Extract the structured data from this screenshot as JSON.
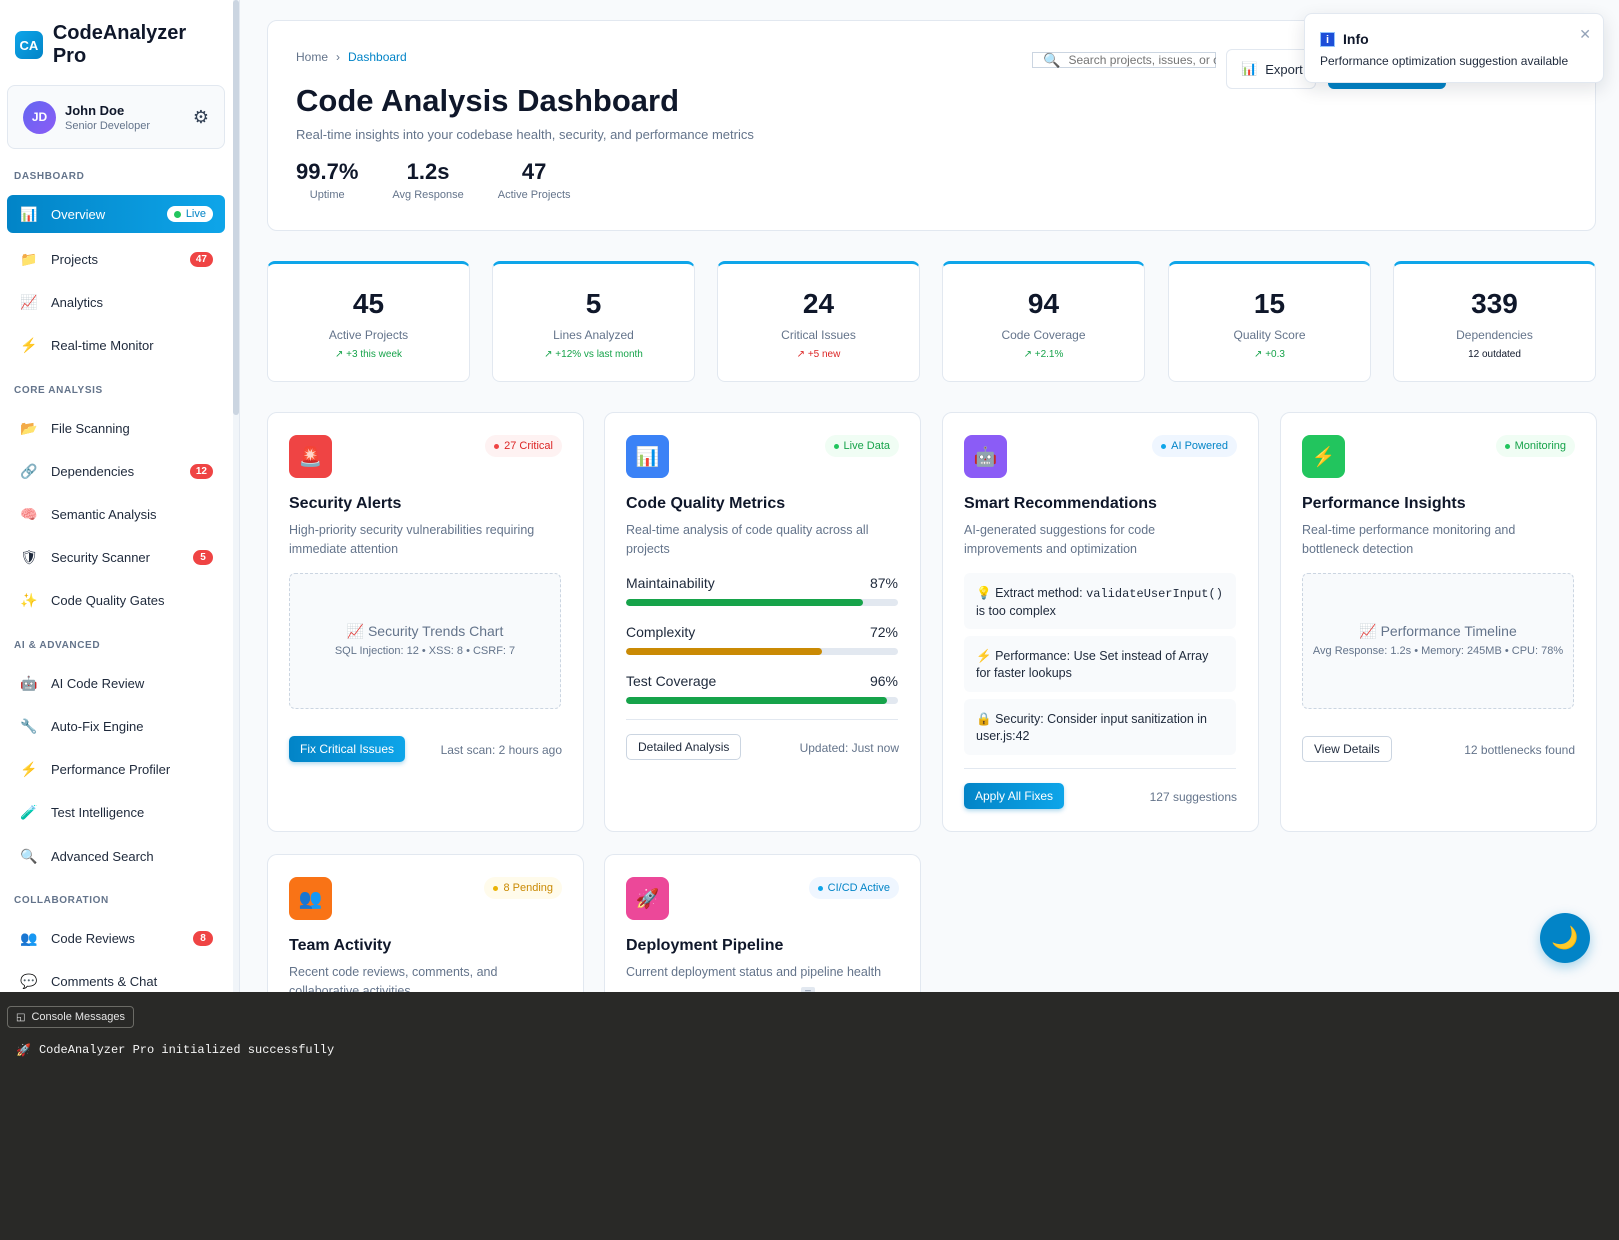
{
  "app": {
    "logo": "CA",
    "name": "CodeAnalyzer Pro"
  },
  "user": {
    "initials": "JD",
    "name": "John Doe",
    "role": "Senior Developer",
    "settings_icon": "gear-icon"
  },
  "sidebar": {
    "sections": [
      {
        "label": "DASHBOARD",
        "items": [
          {
            "icon": "📊",
            "label": "Overview",
            "pill": "Live",
            "active": true
          },
          {
            "icon": "📁",
            "label": "Projects",
            "badge": "47"
          },
          {
            "icon": "📈",
            "label": "Analytics"
          },
          {
            "icon": "⚡",
            "label": "Real-time Monitor"
          }
        ]
      },
      {
        "label": "CORE ANALYSIS",
        "items": [
          {
            "icon": "📂",
            "label": "File Scanning"
          },
          {
            "icon": "🔗",
            "label": "Dependencies",
            "badge": "12"
          },
          {
            "icon": "🧠",
            "label": "Semantic Analysis"
          },
          {
            "icon": "🛡",
            "label": "Security Scanner",
            "badge": "5"
          },
          {
            "icon": "✨",
            "label": "Code Quality Gates"
          }
        ]
      },
      {
        "label": "AI & ADVANCED",
        "items": [
          {
            "icon": "🤖",
            "label": "AI Code Review"
          },
          {
            "icon": "🔧",
            "label": "Auto-Fix Engine"
          },
          {
            "icon": "⚡",
            "label": "Performance Profiler"
          },
          {
            "icon": "🧪",
            "label": "Test Intelligence"
          },
          {
            "icon": "🔍",
            "label": "Advanced Search"
          }
        ]
      },
      {
        "label": "COLLABORATION",
        "items": [
          {
            "icon": "👥",
            "label": "Code Reviews",
            "badge": "8"
          },
          {
            "icon": "💬",
            "label": "Comments & Chat"
          }
        ]
      }
    ]
  },
  "header": {
    "breadcrumb": {
      "home": "Home",
      "separator": "›",
      "current": "Dashboard"
    },
    "title": "Code Analysis Dashboard",
    "subtitle": "Real-time insights into your codebase health, security, and performance metrics",
    "stats": [
      {
        "value": "99.7%",
        "label": "Uptime"
      },
      {
        "value": "1.2s",
        "label": "Avg Response"
      },
      {
        "value": "47",
        "label": "Active Projects"
      }
    ],
    "search_placeholder": "Search projects, issues, or code...",
    "export_label": "Export"
  },
  "toast": {
    "icon": "i",
    "title": "Info",
    "message": "Performance optimization suggestion available",
    "close": "✕"
  },
  "stat_cards": [
    {
      "value": "45",
      "label": "Active Projects",
      "trend": "↗ +3 this week",
      "tone": "up"
    },
    {
      "value": "5",
      "label": "Lines Analyzed",
      "trend": "↗ +12% vs last month",
      "tone": "up"
    },
    {
      "value": "24",
      "label": "Critical Issues",
      "trend": "↗ +5 new",
      "tone": "down"
    },
    {
      "value": "94",
      "label": "Code Coverage",
      "trend": "↗ +2.1%",
      "tone": "up"
    },
    {
      "value": "15",
      "label": "Quality Score",
      "trend": "↗ +0.3",
      "tone": "up"
    },
    {
      "value": "339",
      "label": "Dependencies",
      "trend": "12 outdated",
      "tone": "neutral"
    }
  ],
  "cards": {
    "security": {
      "icon": "🚨",
      "badge": "27 Critical",
      "title": "Security Alerts",
      "desc": "High-priority security vulnerabilities requiring immediate attention",
      "chart_title": "📈 Security Trends Chart",
      "chart_meta": "SQL Injection: 12 • XSS: 8 • CSRF: 7",
      "action": "Fix Critical Issues",
      "footer": "Last scan: 2 hours ago"
    },
    "quality": {
      "icon": "📊",
      "badge": "Live Data",
      "title": "Code Quality Metrics",
      "desc": "Real-time analysis of code quality across all projects",
      "metrics": [
        {
          "label": "Maintainability",
          "value": "87%",
          "fraction": 0.87,
          "color": "#16a34a"
        },
        {
          "label": "Complexity",
          "value": "72%",
          "fraction": 0.72,
          "color": "#ca8a04"
        },
        {
          "label": "Test Coverage",
          "value": "96%",
          "fraction": 0.96,
          "color": "#16a34a"
        }
      ],
      "action": "Detailed Analysis",
      "footer": "Updated: Just now"
    },
    "smart": {
      "icon": "🤖",
      "badge": "AI Powered",
      "title": "Smart Recommendations",
      "desc": "AI-generated suggestions for code improvements and optimization",
      "recs": [
        {
          "icon": "💡",
          "pre": "Extract method: ",
          "code": "validateUserInput()",
          "post": " is too complex"
        },
        {
          "icon": "⚡",
          "pre": "Performance: Use Set instead of Array for faster lookups",
          "code": "",
          "post": ""
        },
        {
          "icon": "🔒",
          "pre": "Security: Consider input sanitization in user.js:42",
          "code": "",
          "post": ""
        }
      ],
      "action": "Apply All Fixes",
      "footer": "127 suggestions"
    },
    "performance": {
      "icon": "⚡",
      "badge": "Monitoring",
      "title": "Performance Insights",
      "desc": "Real-time performance monitoring and bottleneck detection",
      "chart_title": "📈 Performance Timeline",
      "chart_meta": "Avg Response: 1.2s • Memory: 245MB • CPU: 78%",
      "action": "View Details",
      "footer": "12 bottlenecks found"
    },
    "team": {
      "icon": "👥",
      "badge": "8 Pending",
      "title": "Team Activity",
      "desc": "Recent code reviews, comments, and collaborative activities"
    },
    "deploy": {
      "icon": "🚀",
      "badge": "CI/CD Active",
      "title": "Deployment Pipeline",
      "desc": "Current deployment status and pipeline health"
    }
  },
  "fab_icon": "🌙",
  "console": {
    "tab_label": "Console Messages",
    "messages": [
      {
        "icon": "🚀",
        "text": "CodeAnalyzer Pro initialized successfully"
      }
    ]
  },
  "colors": {
    "accent": "#0284c7",
    "accent_light": "#0ea5e9",
    "danger": "#ef4444",
    "success": "#16a34a",
    "warning": "#ca8a04",
    "console_bg": "#292927"
  }
}
